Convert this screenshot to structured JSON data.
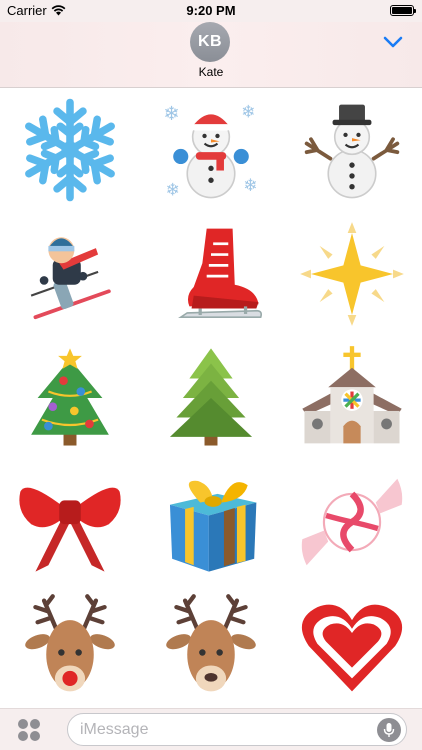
{
  "status_bar": {
    "carrier": "Carrier",
    "time": "9:20 PM",
    "battery_level": 1.0
  },
  "header": {
    "initials": "KB",
    "name": "Kate"
  },
  "stickers": [
    {
      "name": "snowflake"
    },
    {
      "name": "snowman-with-snowflakes"
    },
    {
      "name": "snowman-with-hat"
    },
    {
      "name": "skier"
    },
    {
      "name": "ice-skate"
    },
    {
      "name": "star"
    },
    {
      "name": "christmas-tree-decorated"
    },
    {
      "name": "evergreen-tree"
    },
    {
      "name": "church"
    },
    {
      "name": "red-bow"
    },
    {
      "name": "gift-box"
    },
    {
      "name": "candy"
    },
    {
      "name": "reindeer-red-nose"
    },
    {
      "name": "reindeer"
    },
    {
      "name": "heart"
    }
  ],
  "composer": {
    "placeholder": "iMessage"
  },
  "colors": {
    "accent": "#1a7cf5",
    "header_bg": "#f7e9e9",
    "avatar": "#9a9da4"
  }
}
